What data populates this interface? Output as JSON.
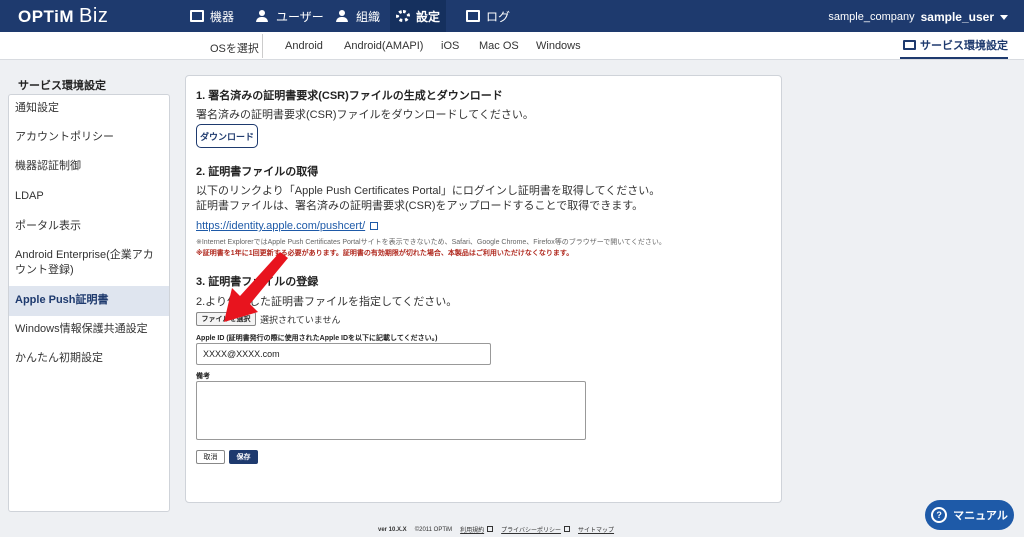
{
  "brand": {
    "optim": "OPTiM",
    "biz": "Biz"
  },
  "nav": {
    "items": [
      {
        "label": "機器",
        "icon": "device-icon"
      },
      {
        "label": "ユーザー",
        "icon": "user-icon"
      },
      {
        "label": "組織",
        "icon": "organization-icon"
      },
      {
        "label": "設定",
        "icon": "gear-icon"
      },
      {
        "label": "ログ",
        "icon": "log-icon"
      }
    ],
    "company": "sample_company",
    "user": "sample_user"
  },
  "subnav": {
    "os_label": "OSを選択",
    "tabs": [
      "Android",
      "Android(AMAPI)",
      "iOS",
      "Mac OS",
      "Windows"
    ],
    "service_button": "サービス環境設定"
  },
  "sidebar": {
    "title": "サービス環境設定",
    "items": [
      "通知設定",
      "アカウントポリシー",
      "機器認証制御",
      "LDAP",
      "ポータル表示",
      "Android Enterprise(企業アカウント登録)",
      "Apple Push証明書",
      "Windows情報保護共通設定",
      "かんたん初期設定"
    ],
    "active_index": 6
  },
  "main": {
    "step1": {
      "title": "1. 署名済みの証明書要求(CSR)ファイルの生成とダウンロード",
      "desc": "署名済みの証明書要求(CSR)ファイルをダウンロードしてください。",
      "download": "ダウンロード"
    },
    "step2": {
      "title": "2. 証明書ファイルの取得",
      "desc1": "以下のリンクより「Apple Push Certificates Portal」にログインし証明書を取得してください。",
      "desc2": "証明書ファイルは、署名済みの証明書要求(CSR)をアップロードすることで取得できます。",
      "link": "https://identity.apple.com/pushcert/",
      "note": "※Internet ExplorerではApple Push Certificates Portalサイトを表示できないため、Safari、Google Chrome、Firefox等のブラウザーで開いてください。",
      "warning": "※証明書を1年に1回更新する必要があります。証明書の有効期限が切れた場合、本製品はご利用いただけなくなります。"
    },
    "step3": {
      "title": "3. 証明書ファイルの登録",
      "desc": "2.より作成した証明書ファイルを指定してください。",
      "file_button": "ファイルを選択",
      "file_status": "選択されていません",
      "appleid_label": "Apple ID (証明書発行の際に使用されたApple IDを以下に記載してください。)",
      "appleid_value": "XXXX@XXXX.com",
      "memo_label": "備考",
      "cancel": "取消",
      "save": "保存"
    }
  },
  "footer": {
    "version": "ver 10.X.X",
    "copyright": "©2011 OPTiM",
    "links": [
      "利用規約",
      "プライバシーポリシー",
      "サイトマップ"
    ]
  },
  "manual": {
    "label": "マニュアル"
  },
  "colors": {
    "navy": "#1e3a6e",
    "link": "#1e5aa8",
    "warning": "#b0281e",
    "arrow": "#e8141e"
  }
}
